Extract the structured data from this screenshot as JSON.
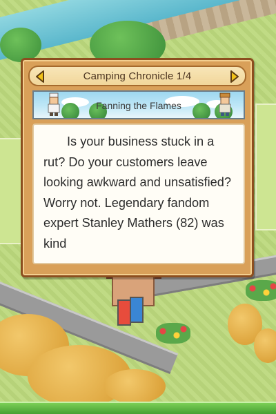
{
  "dialog": {
    "title": "Camping Chronicle 1/4",
    "prev_icon": "triangle-left-icon",
    "next_icon": "triangle-right-icon"
  },
  "banner": {
    "title": "Fanning the Flames"
  },
  "article": {
    "body": "Is your business stuck in a rut? Do your customers leave looking awkward and unsatisfied? Worry not. Legendary fandom expert Stanley Mathers (82) was kind"
  },
  "colors": {
    "frame": "#d9a059",
    "frame_border": "#8c4e1f",
    "title_bar": "#f4dda6",
    "arrow": "#f2c21a",
    "paper": "#fffdf6",
    "sky": "#9ed8f0",
    "grass": "#bcd97d",
    "bottom_bar": "#5cb53f"
  }
}
